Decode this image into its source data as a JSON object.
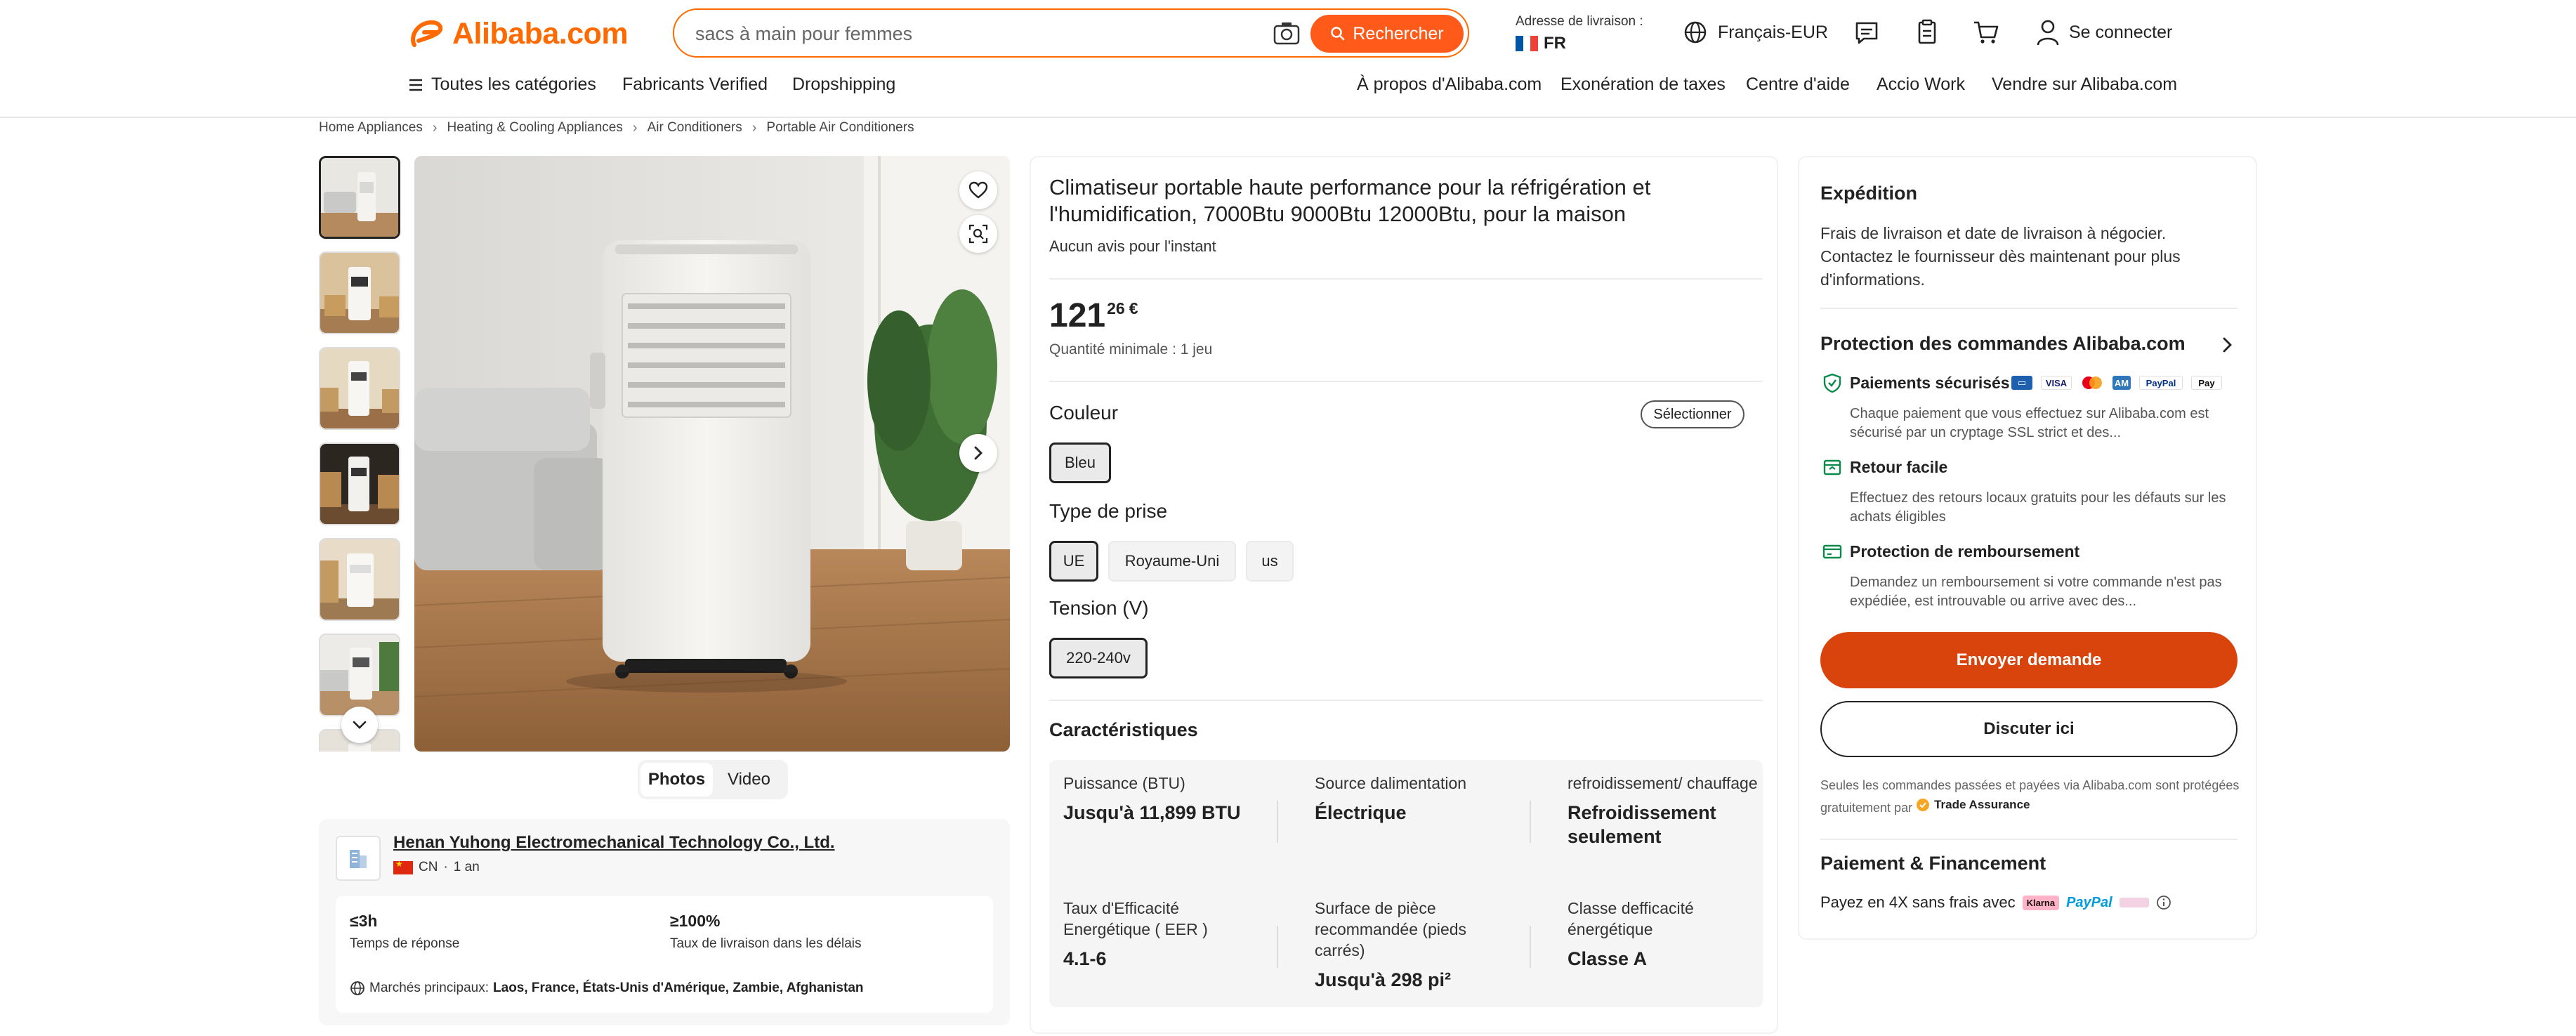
{
  "header": {
    "logo_text": "Alibaba.com",
    "search_placeholder": "sacs à main pour femmes",
    "search_button": "Rechercher",
    "delivery_label": "Adresse de livraison :",
    "delivery_country": "FR",
    "language": "Français-EUR",
    "signin": "Se connecter",
    "nav_left": [
      "Toutes les catégories",
      "Fabricants Verified",
      "Dropshipping"
    ],
    "nav_right": [
      "À propos d'Alibaba.com",
      "Exonération de taxes",
      "Centre d'aide",
      "Accio Work",
      "Vendre sur Alibaba.com"
    ],
    "accent_color": "#ff6a00"
  },
  "breadcrumb": [
    "Home Appliances",
    "Heating & Cooling Appliances",
    "Air Conditioners",
    "Portable Air Conditioners"
  ],
  "gallery": {
    "tabs": [
      "Photos",
      "Video"
    ],
    "active_tab": "Photos"
  },
  "supplier": {
    "name": "Henan Yuhong Electromechanical Technology Co., Ltd.",
    "country": "CN",
    "years": "1 an",
    "stats": [
      {
        "value": "≤3h",
        "label": "Temps de réponse"
      },
      {
        "value": "≥100%",
        "label": "Taux de livraison dans les délais"
      }
    ],
    "markets_label": "Marchés principaux:",
    "markets": "Laos, France, États-Unis d'Amérique, Zambie, Afghanistan"
  },
  "product": {
    "title": "Climatiseur portable haute performance pour la réfrigération et l'humidification, 7000Btu 9000Btu 12000Btu, pour la maison",
    "reviews": "Aucun avis pour l'instant",
    "price_int": "121",
    "price_dec": "26",
    "currency": "€",
    "moq": "Quantité minimale : 1 jeu",
    "color_label": "Couleur",
    "select_label": "Sélectionner",
    "colors": [
      "Bleu"
    ],
    "plug_label": "Type de prise",
    "plugs": [
      "UE",
      "Royaume-Uni",
      "us"
    ],
    "voltage_label": "Tension (V)",
    "voltages": [
      "220-240v"
    ],
    "specs_title": "Caractéristiques",
    "specs": [
      {
        "label": "Puissance (BTU)",
        "value": "Jusqu'à 11,899 BTU"
      },
      {
        "label": "Source dalimentation",
        "value": "Électrique"
      },
      {
        "label": "refroidissement/ chauffage",
        "value": "Refroidissement seulement"
      },
      {
        "label": "Taux d'Efficacité Energétique ( EER )",
        "value": "4.1-6"
      },
      {
        "label": "Surface de pièce recommandée (pieds carrés)",
        "value": "Jusqu'à 298 pi²"
      },
      {
        "label": "Classe defficacité énergétique",
        "value": "Classe A"
      }
    ]
  },
  "side": {
    "shipping_title": "Expédition",
    "shipping_text": "Frais de livraison et date de livraison à négocier. Contactez le fournisseur dès maintenant pour plus d'informations.",
    "protection_title": "Protection des commandes Alibaba.com",
    "protections": [
      {
        "title": "Paiements sécurisés",
        "desc": "Chaque paiement que vous effectuez sur Alibaba.com est sécurisé par un cryptage SSL strict et des..."
      },
      {
        "title": "Retour facile",
        "desc": "Effectuez des retours locaux gratuits pour les défauts sur les achats éligibles"
      },
      {
        "title": "Protection de remboursement",
        "desc": "Demandez un remboursement si votre commande n'est pas expédiée, est introuvable ou arrive avec des..."
      }
    ],
    "payment_badges": [
      "VISA",
      "Mastercard",
      "Amex",
      "PayPal",
      "Apple Pay"
    ],
    "send_button": "Envoyer demande",
    "chat_button": "Discuter ici",
    "ta_note": "Seules les commandes passées et payées via Alibaba.com sont protégées gratuitement par",
    "ta_badge": "Trade Assurance",
    "financing_title": "Paiement & Financement",
    "financing_text": "Payez en 4X sans frais avec",
    "klarna": "Klarna",
    "paypal": "PayPal"
  }
}
